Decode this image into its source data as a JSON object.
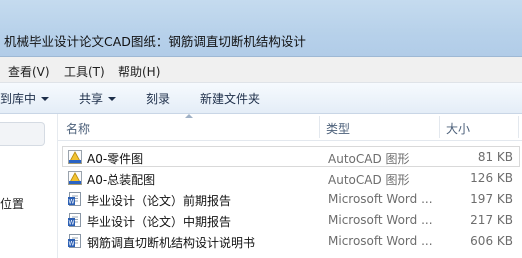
{
  "window": {
    "title": "机械毕业设计论文CAD图纸：钢筋调直切断机结构设计"
  },
  "menu": {
    "items": [
      {
        "label": "查看(V)"
      },
      {
        "label": "工具(T)"
      },
      {
        "label": "帮助(H)"
      }
    ]
  },
  "toolbar": {
    "include_library": "到库中",
    "share": "共享",
    "burn": "刻录",
    "new_folder": "新建文件夹"
  },
  "nav": {
    "location_label": "位置"
  },
  "columns": {
    "name": "名称",
    "type": "类型",
    "size": "大小"
  },
  "files": [
    {
      "name": "A0-零件图",
      "type": "AutoCAD 图形",
      "size": "81 KB",
      "icon": "autocad-drawing-icon"
    },
    {
      "name": "A0-总装配图",
      "type": "AutoCAD 图形",
      "size": "126 KB",
      "icon": "autocad-drawing-icon"
    },
    {
      "name": "毕业设计（论文）前期报告",
      "type": "Microsoft Word ...",
      "size": "197 KB",
      "icon": "word-document-icon"
    },
    {
      "name": "毕业设计（论文）中期报告",
      "type": "Microsoft Word ...",
      "size": "217 KB",
      "icon": "word-document-icon"
    },
    {
      "name": "钢筋调直切断机结构设计说明书",
      "type": "Microsoft Word ...",
      "size": "606 KB",
      "icon": "word-document-icon"
    }
  ]
}
